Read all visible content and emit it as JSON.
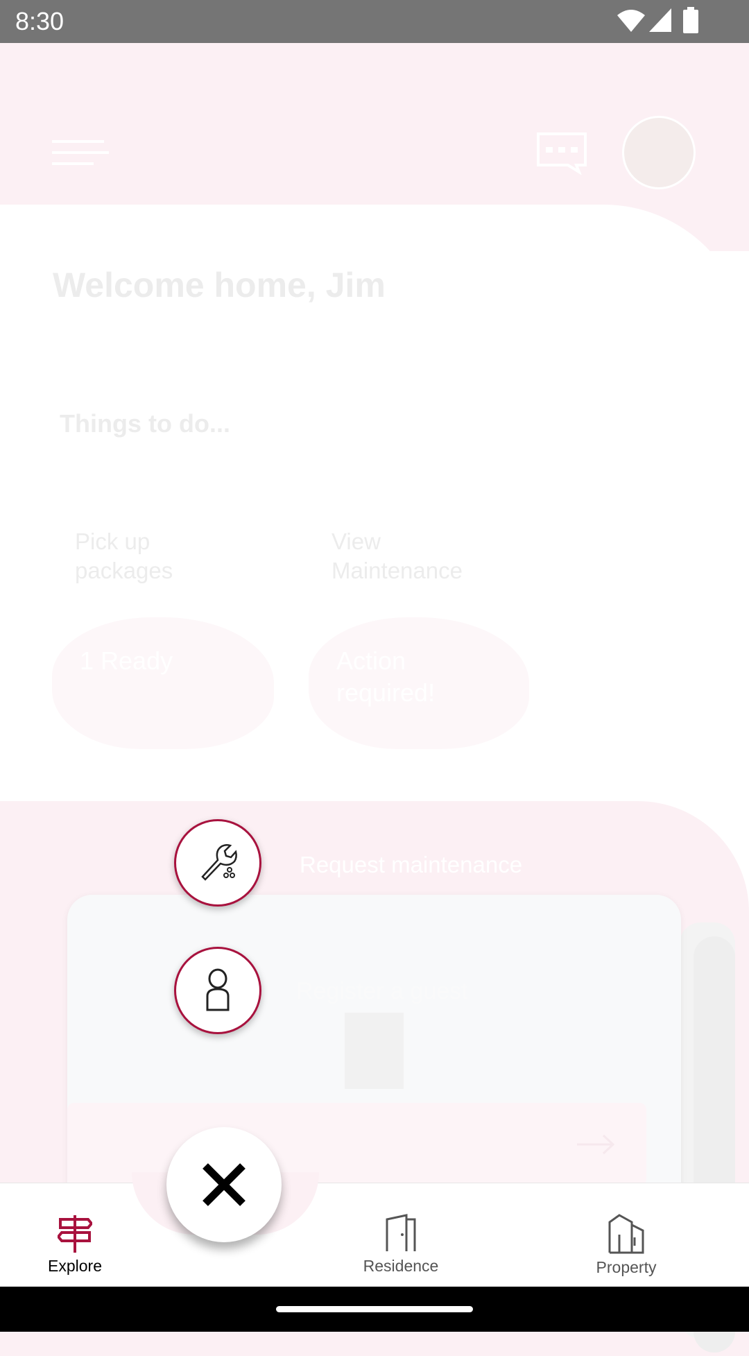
{
  "status_bar": {
    "time": "8:30",
    "icons": [
      "wifi-icon",
      "signal-icon",
      "battery-icon"
    ]
  },
  "header": {
    "menu_icon": "hamburger-icon",
    "chat_icon": "chat-icon",
    "avatar": "avatar"
  },
  "welcome": "Welcome home, Jim",
  "things_to_do": {
    "title": "Things to do...",
    "cards": [
      {
        "title": "Pick up packages",
        "status": "1 Ready"
      },
      {
        "title": "View Maintenance",
        "status": "Action required!"
      }
    ]
  },
  "feature_card": {
    "title": "Request maintenance",
    "subtitle": "Register a guest"
  },
  "fab_menu": {
    "actions": [
      "wrench-icon",
      "person-icon"
    ],
    "close_icon": "close-icon",
    "accent": "#a8123e"
  },
  "bottom_nav": {
    "items": [
      {
        "label": "Explore",
        "icon": "signpost-icon",
        "active": true
      },
      {
        "label": "Residence",
        "icon": "door-icon",
        "active": false
      },
      {
        "label": "Property",
        "icon": "building-icon",
        "active": false
      }
    ],
    "active_color": "#a8123e"
  }
}
